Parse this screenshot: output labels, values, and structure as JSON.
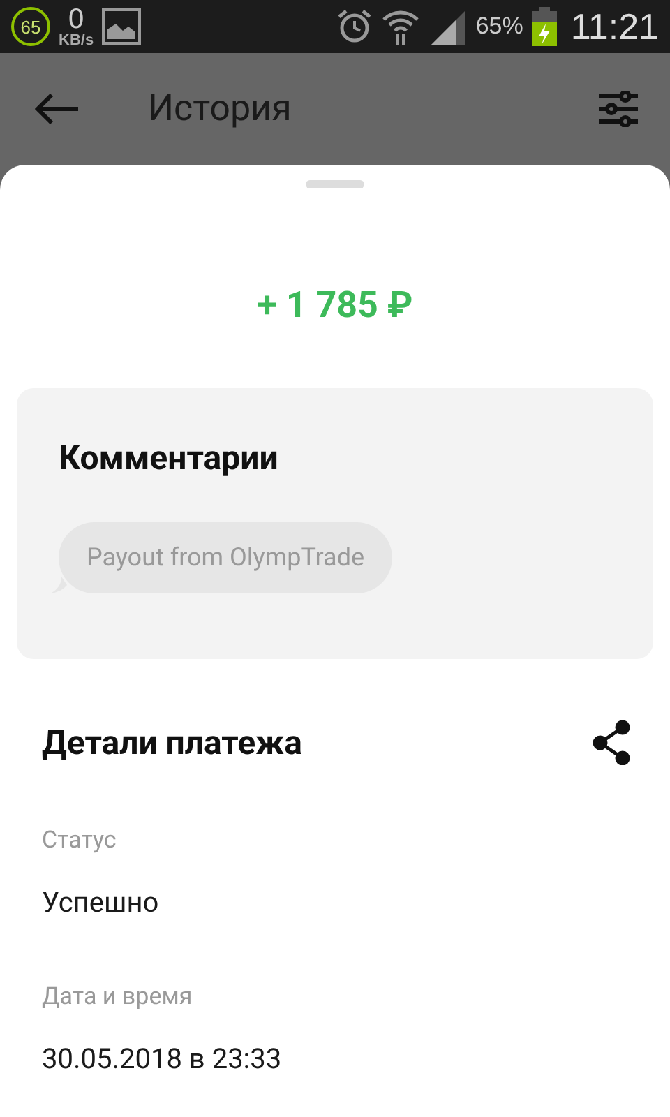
{
  "status_bar": {
    "badge": "65",
    "speed_value": "0",
    "speed_unit": "KB/s",
    "battery_percent": "65%",
    "time": "11:21"
  },
  "header": {
    "title": "История"
  },
  "amount": "+ 1 785 ₽",
  "comments": {
    "title": "Комментарии",
    "message": "Payout from OlympTrade"
  },
  "details": {
    "title": "Детали платежа",
    "fields": [
      {
        "label": "Статус",
        "value": "Успешно"
      },
      {
        "label": "Дата и время",
        "value": "30.05.2018 в 23:33"
      }
    ]
  }
}
